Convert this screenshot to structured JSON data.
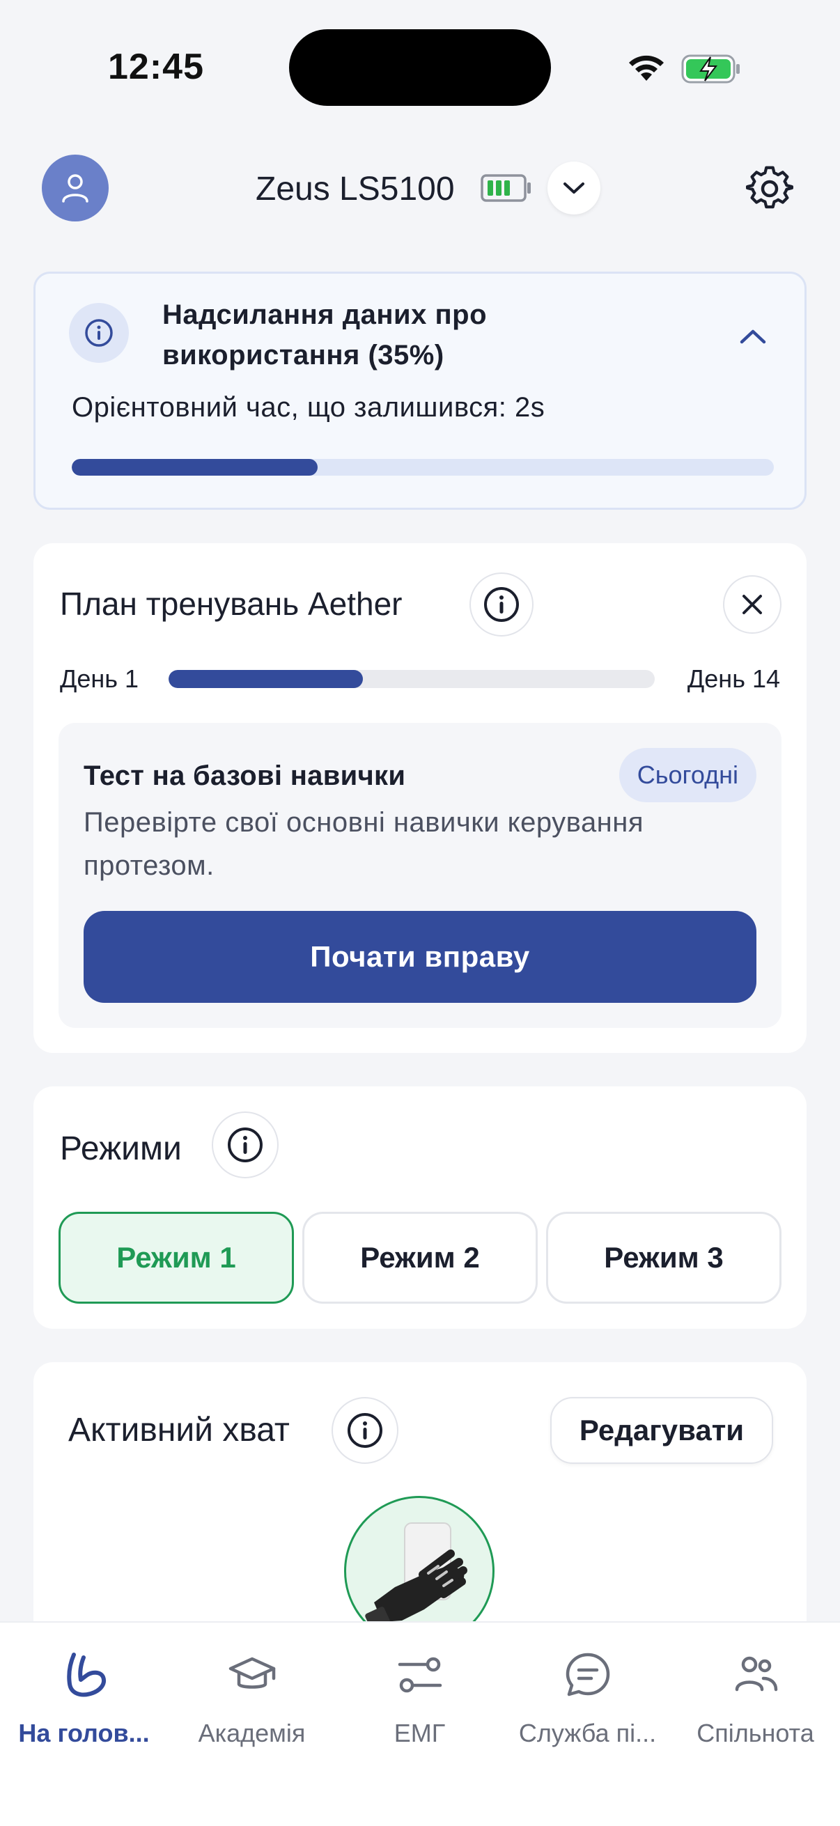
{
  "status_bar": {
    "time": "12:45"
  },
  "header": {
    "device_name": "Zeus LS5100"
  },
  "upload": {
    "title": "Надсилання даних про використання (35%)",
    "eta": "Орієнтовний час, що залишився: 2s",
    "progress": 0.35
  },
  "plan": {
    "title": "План тренувань Aether",
    "day_start": "День 1",
    "day_end": "День 14",
    "progress": 0.4,
    "exercise": {
      "title": "Тест на базові навички",
      "badge": "Сьогодні",
      "description": "Перевірте свої основні навички керування протезом.",
      "button": "Почати вправу"
    }
  },
  "modes": {
    "title": "Режими",
    "items": [
      {
        "label": "Режим 1",
        "active": true
      },
      {
        "label": "Режим 2",
        "active": false
      },
      {
        "label": "Режим 3",
        "active": false
      }
    ]
  },
  "grip": {
    "title": "Активний хват",
    "edit_label": "Редагувати"
  },
  "nav": {
    "items": [
      {
        "label": "На голов...",
        "icon": "arm-icon",
        "active": true
      },
      {
        "label": "Академія",
        "icon": "graduation-cap-icon",
        "active": false
      },
      {
        "label": "ЕМГ",
        "icon": "sliders-icon",
        "active": false
      },
      {
        "label": "Служба пі...",
        "icon": "chat-icon",
        "active": false
      },
      {
        "label": "Спільнота",
        "icon": "people-icon",
        "active": false
      }
    ]
  },
  "colors": {
    "primary": "#334b9b",
    "success": "#1f9a55",
    "background": "#f4f5f8"
  }
}
